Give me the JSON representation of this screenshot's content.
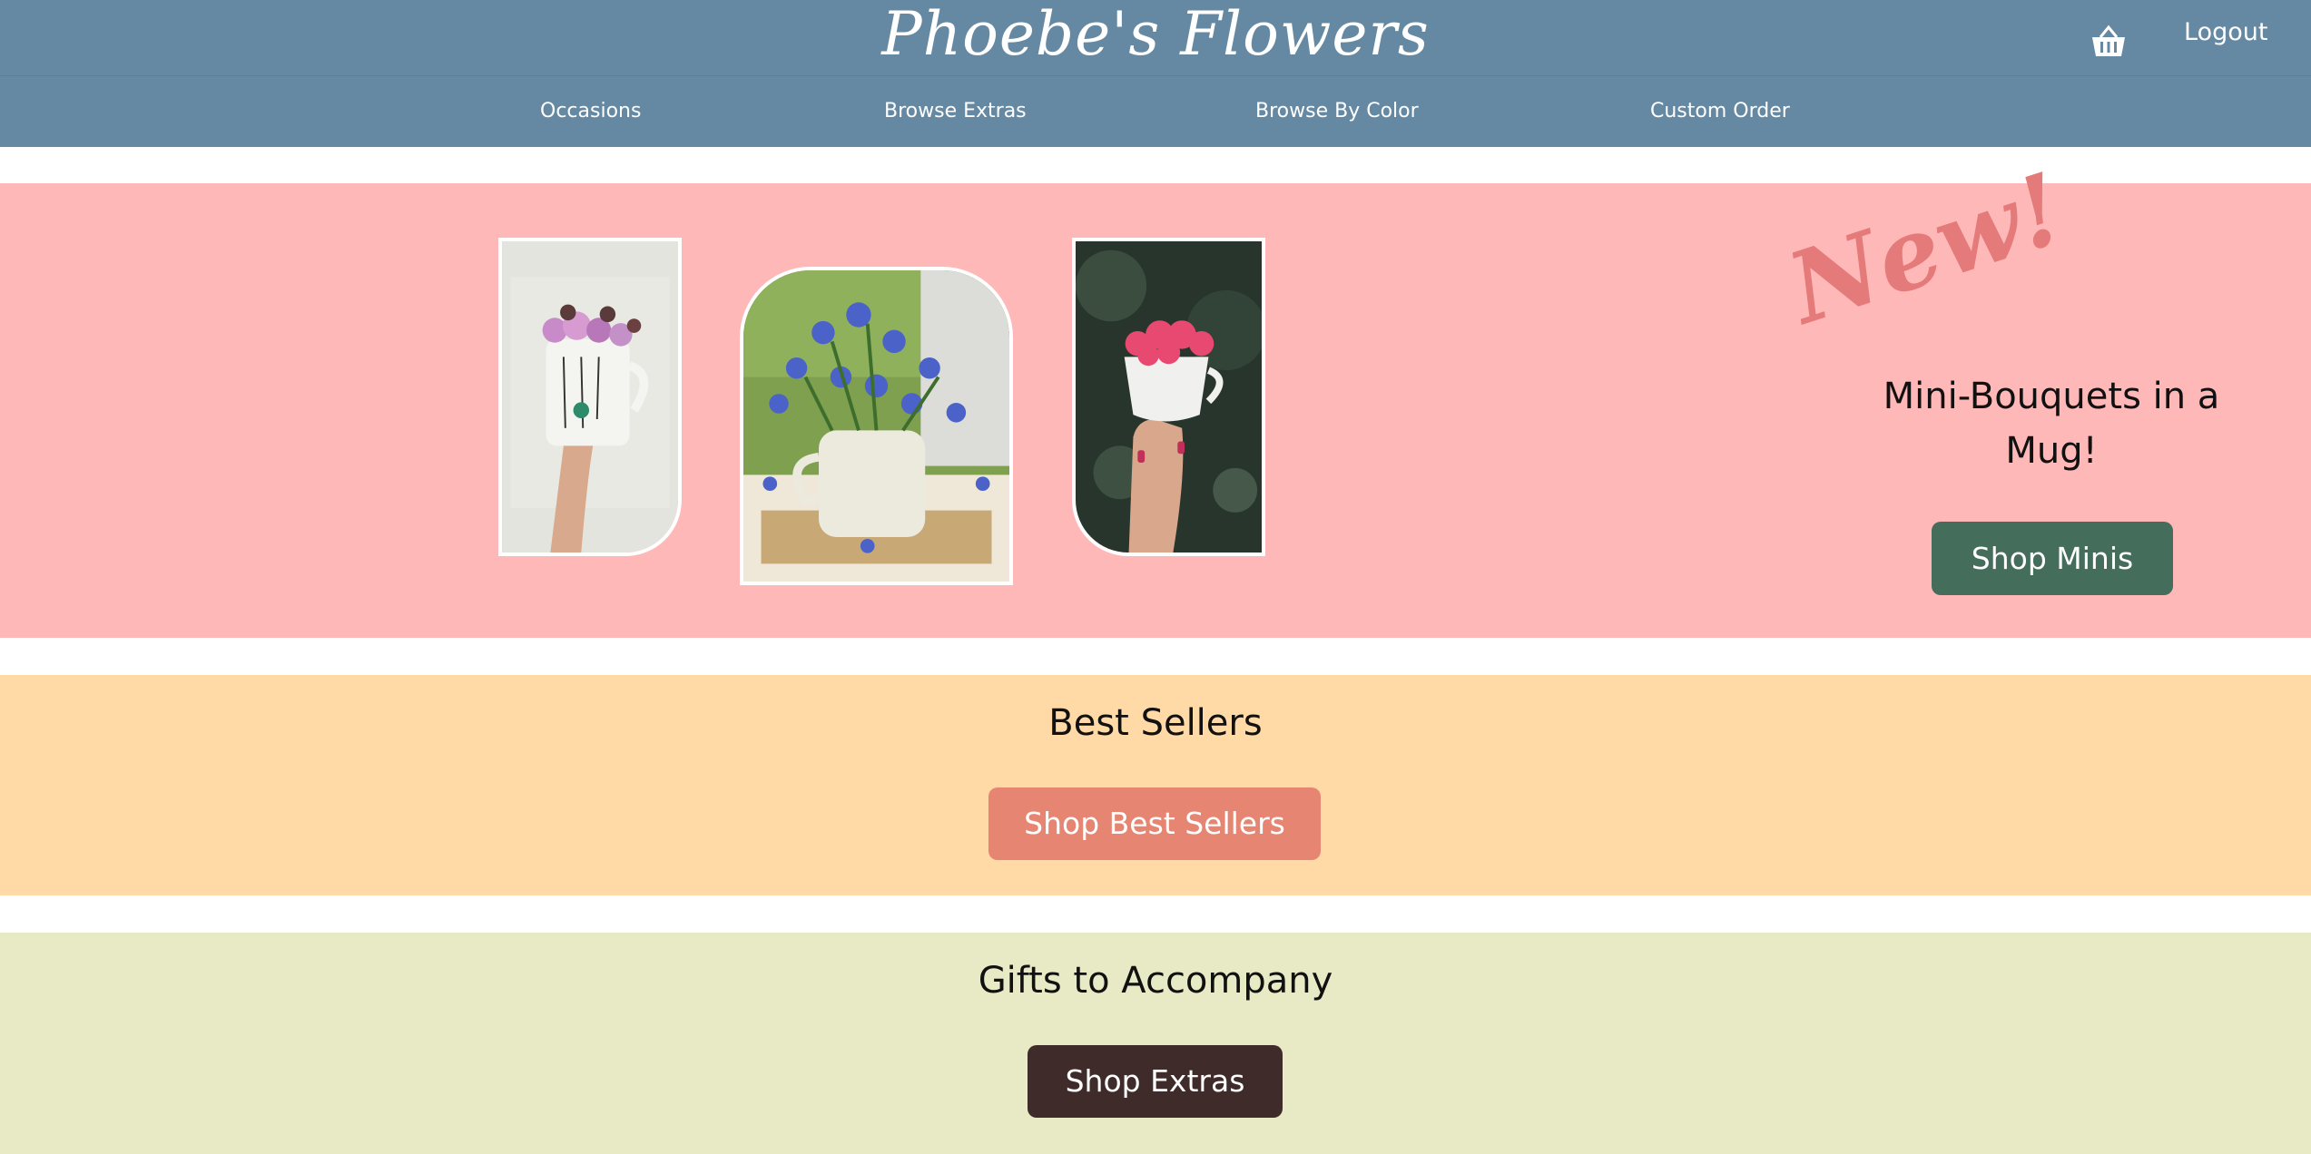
{
  "header": {
    "brand": "Phoebe's Flowers",
    "logout_label": "Logout",
    "cart_icon": "basket-icon"
  },
  "nav": {
    "items": [
      {
        "label": "Occasions"
      },
      {
        "label": "Browse Extras"
      },
      {
        "label": "Browse By Color"
      },
      {
        "label": "Custom Order"
      }
    ]
  },
  "hero": {
    "tag": "New!",
    "headline": "Mini-Bouquets in a Mug!",
    "button_label": "Shop Minis"
  },
  "best_sellers": {
    "title": "Best Sellers",
    "button_label": "Shop Best Sellers"
  },
  "gifts": {
    "title": "Gifts to Accompany",
    "button_label": "Shop Extras"
  },
  "colors": {
    "header_bg": "#6589a3",
    "hero_bg": "#ffb8b8",
    "best_bg": "#ffd9a6",
    "gifts_bg": "#e8eac5",
    "minis_button": "#456d5b",
    "best_button": "#e68572",
    "extras_button": "#3f2c2a",
    "new_tag": "#e47a7a"
  }
}
